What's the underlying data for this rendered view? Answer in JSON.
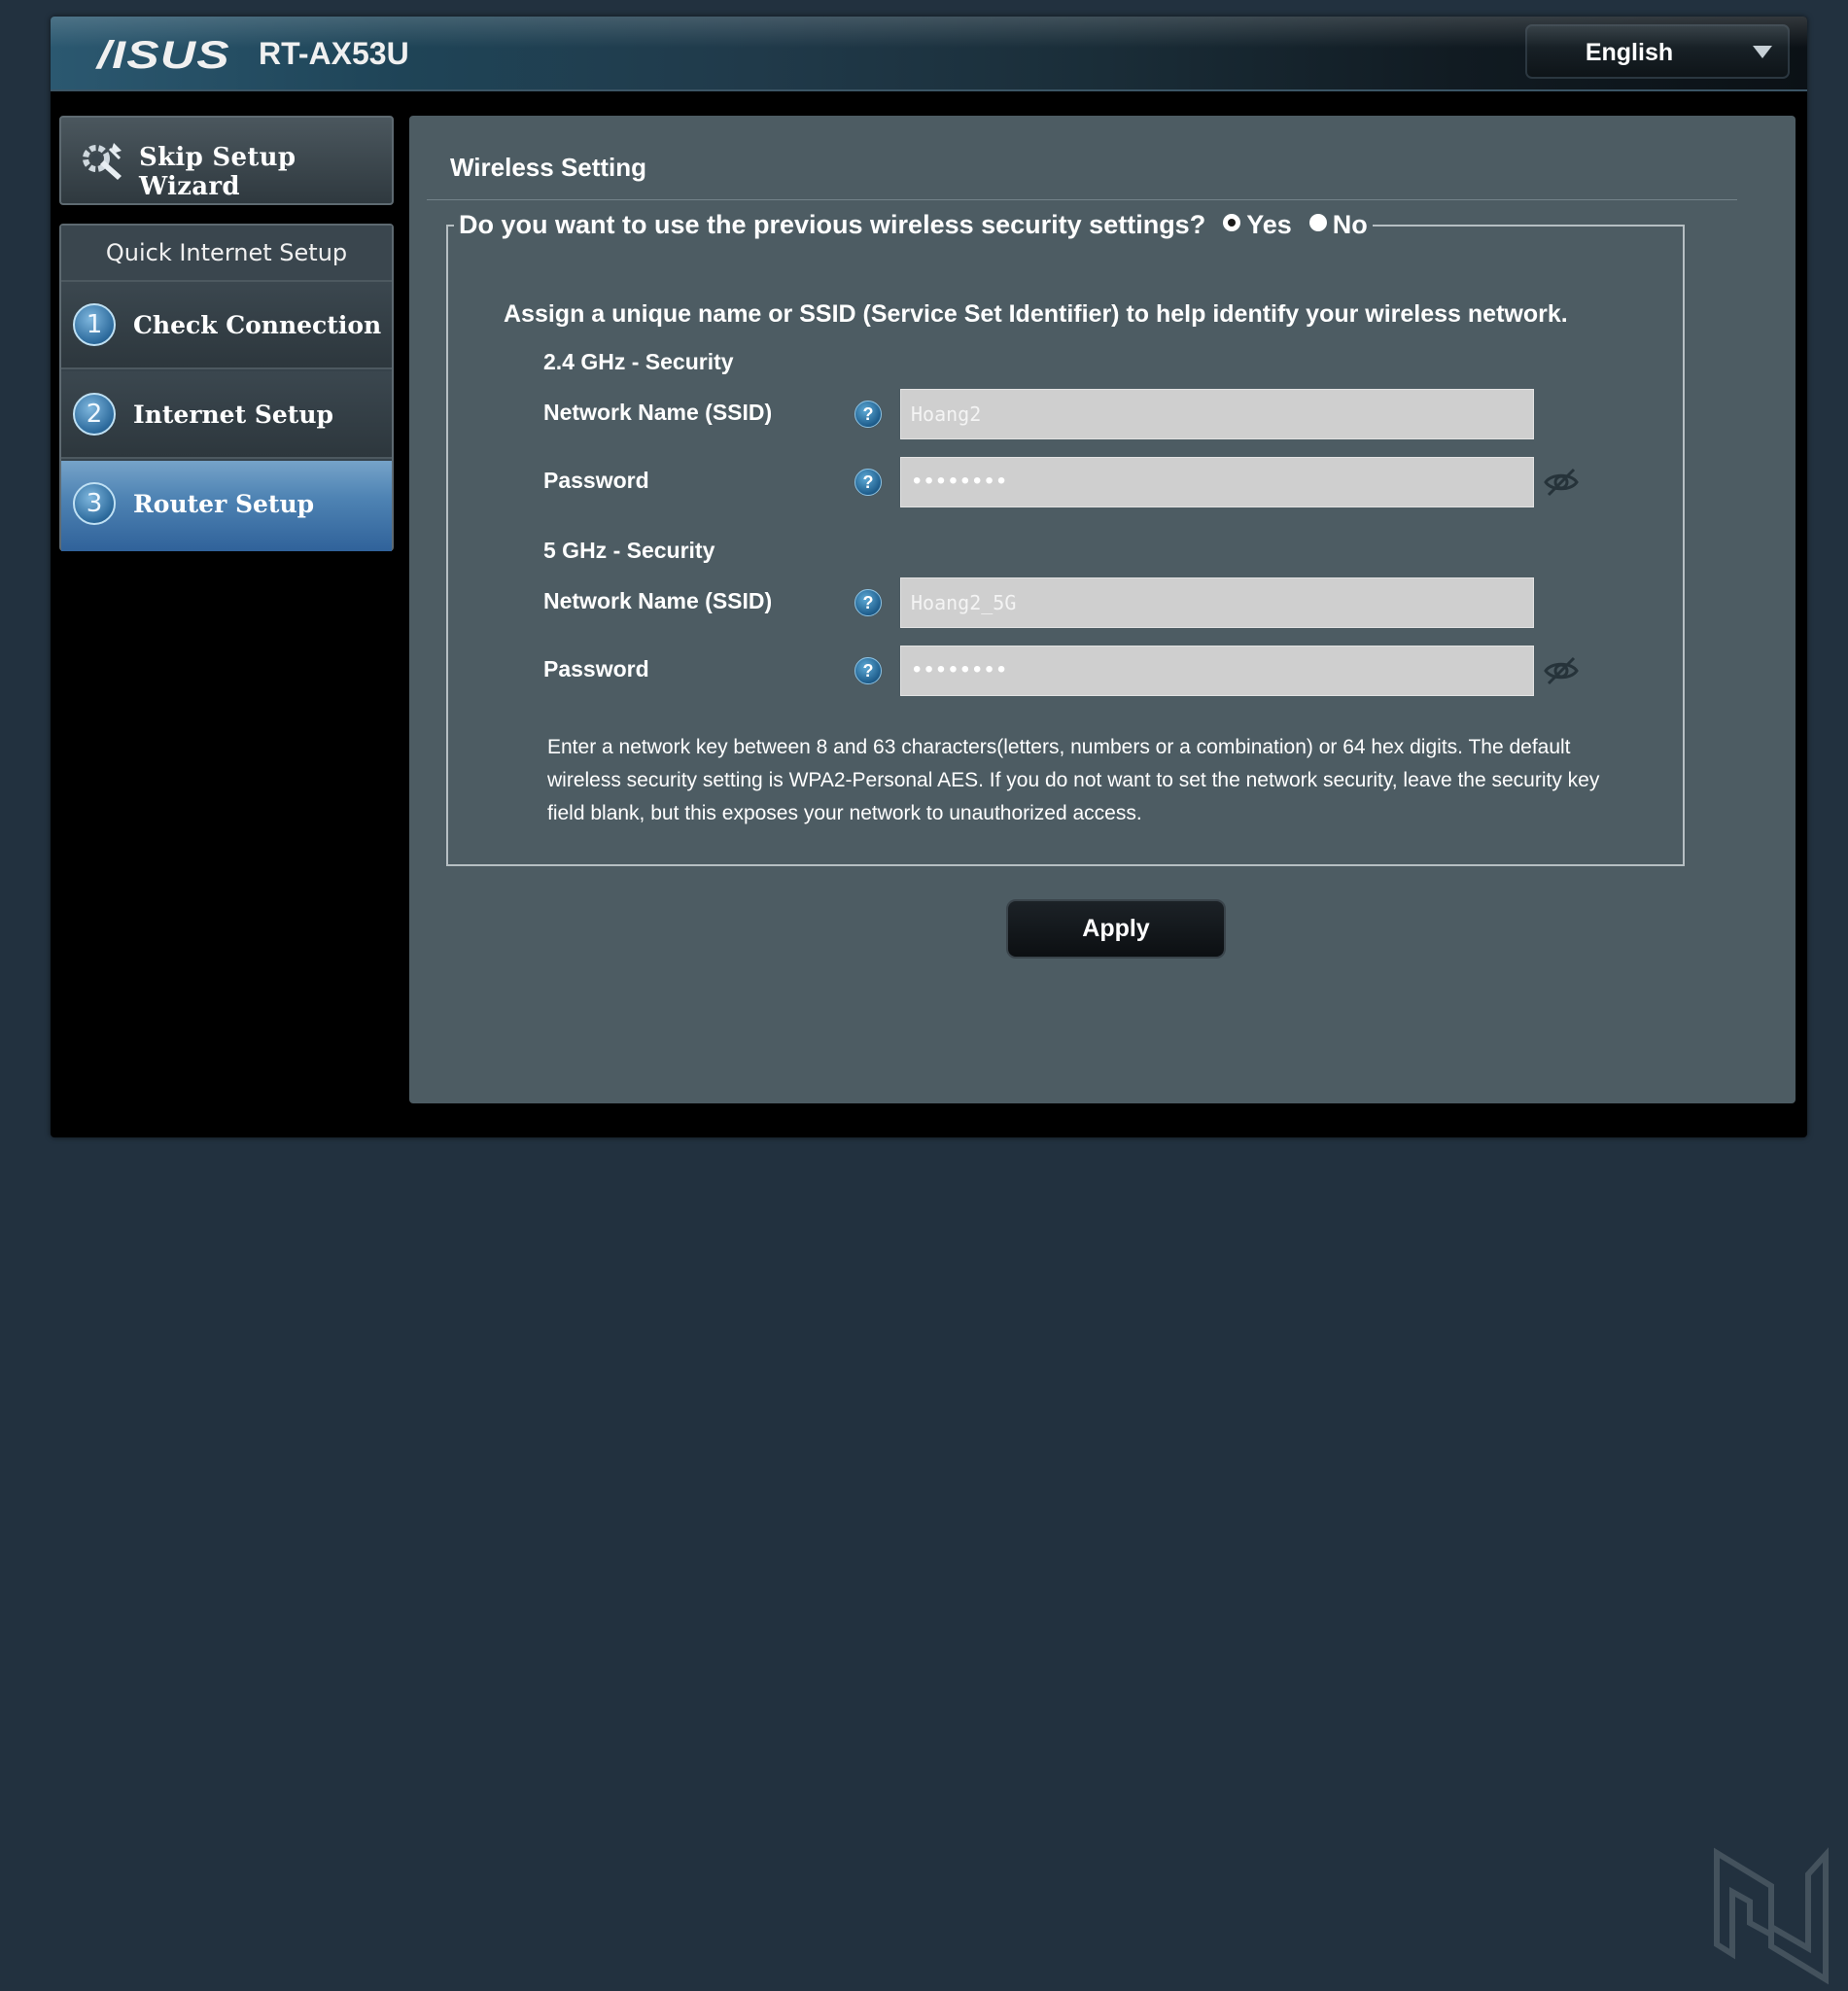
{
  "header": {
    "brand": "/ISUS",
    "model": "RT-AX53U",
    "language": "English"
  },
  "sidebar": {
    "skip_label": "Skip Setup Wizard",
    "section_title": "Quick Internet Setup",
    "steps": [
      {
        "number": "1",
        "label": "Check Connection",
        "active": false
      },
      {
        "number": "2",
        "label": "Internet Setup",
        "active": false
      },
      {
        "number": "3",
        "label": "Router Setup",
        "active": true
      }
    ]
  },
  "main": {
    "title": "Wireless Setting",
    "question": "Do you want to use the previous wireless security settings?",
    "options": {
      "yes": "Yes",
      "no": "No",
      "selected": "yes"
    },
    "assign_text": "Assign a unique name or SSID (Service Set Identifier) to help identify your wireless network.",
    "band24": {
      "heading": "2.4 GHz - Security",
      "ssid_label": "Network Name (SSID)",
      "ssid_value": "Hoang2",
      "password_label": "Password",
      "password_mask": "••••••••"
    },
    "band5": {
      "heading": "5 GHz - Security",
      "ssid_label": "Network Name (SSID)",
      "ssid_value": "Hoang2_5G",
      "password_label": "Password",
      "password_mask": "••••••••"
    },
    "help_glyph": "?",
    "note": "Enter a network key between 8 and 63 characters(letters, numbers or a combination) or 64 hex digits. The default wireless security setting is WPA2-Personal AES. If you do not want to set the network security, leave the security key field blank, but this exposes your network to unauthorized access.",
    "apply_label": "Apply"
  },
  "colors": {
    "page_bg": "#22313f",
    "panel_bg": "#4d5c63",
    "active_step": "#4f84b4",
    "input_bg": "#cfcfcf"
  },
  "icons": [
    "wizard-wrench-icon",
    "help-icon",
    "eye-slash-icon",
    "chevron-down-icon",
    "watermark-logo"
  ]
}
